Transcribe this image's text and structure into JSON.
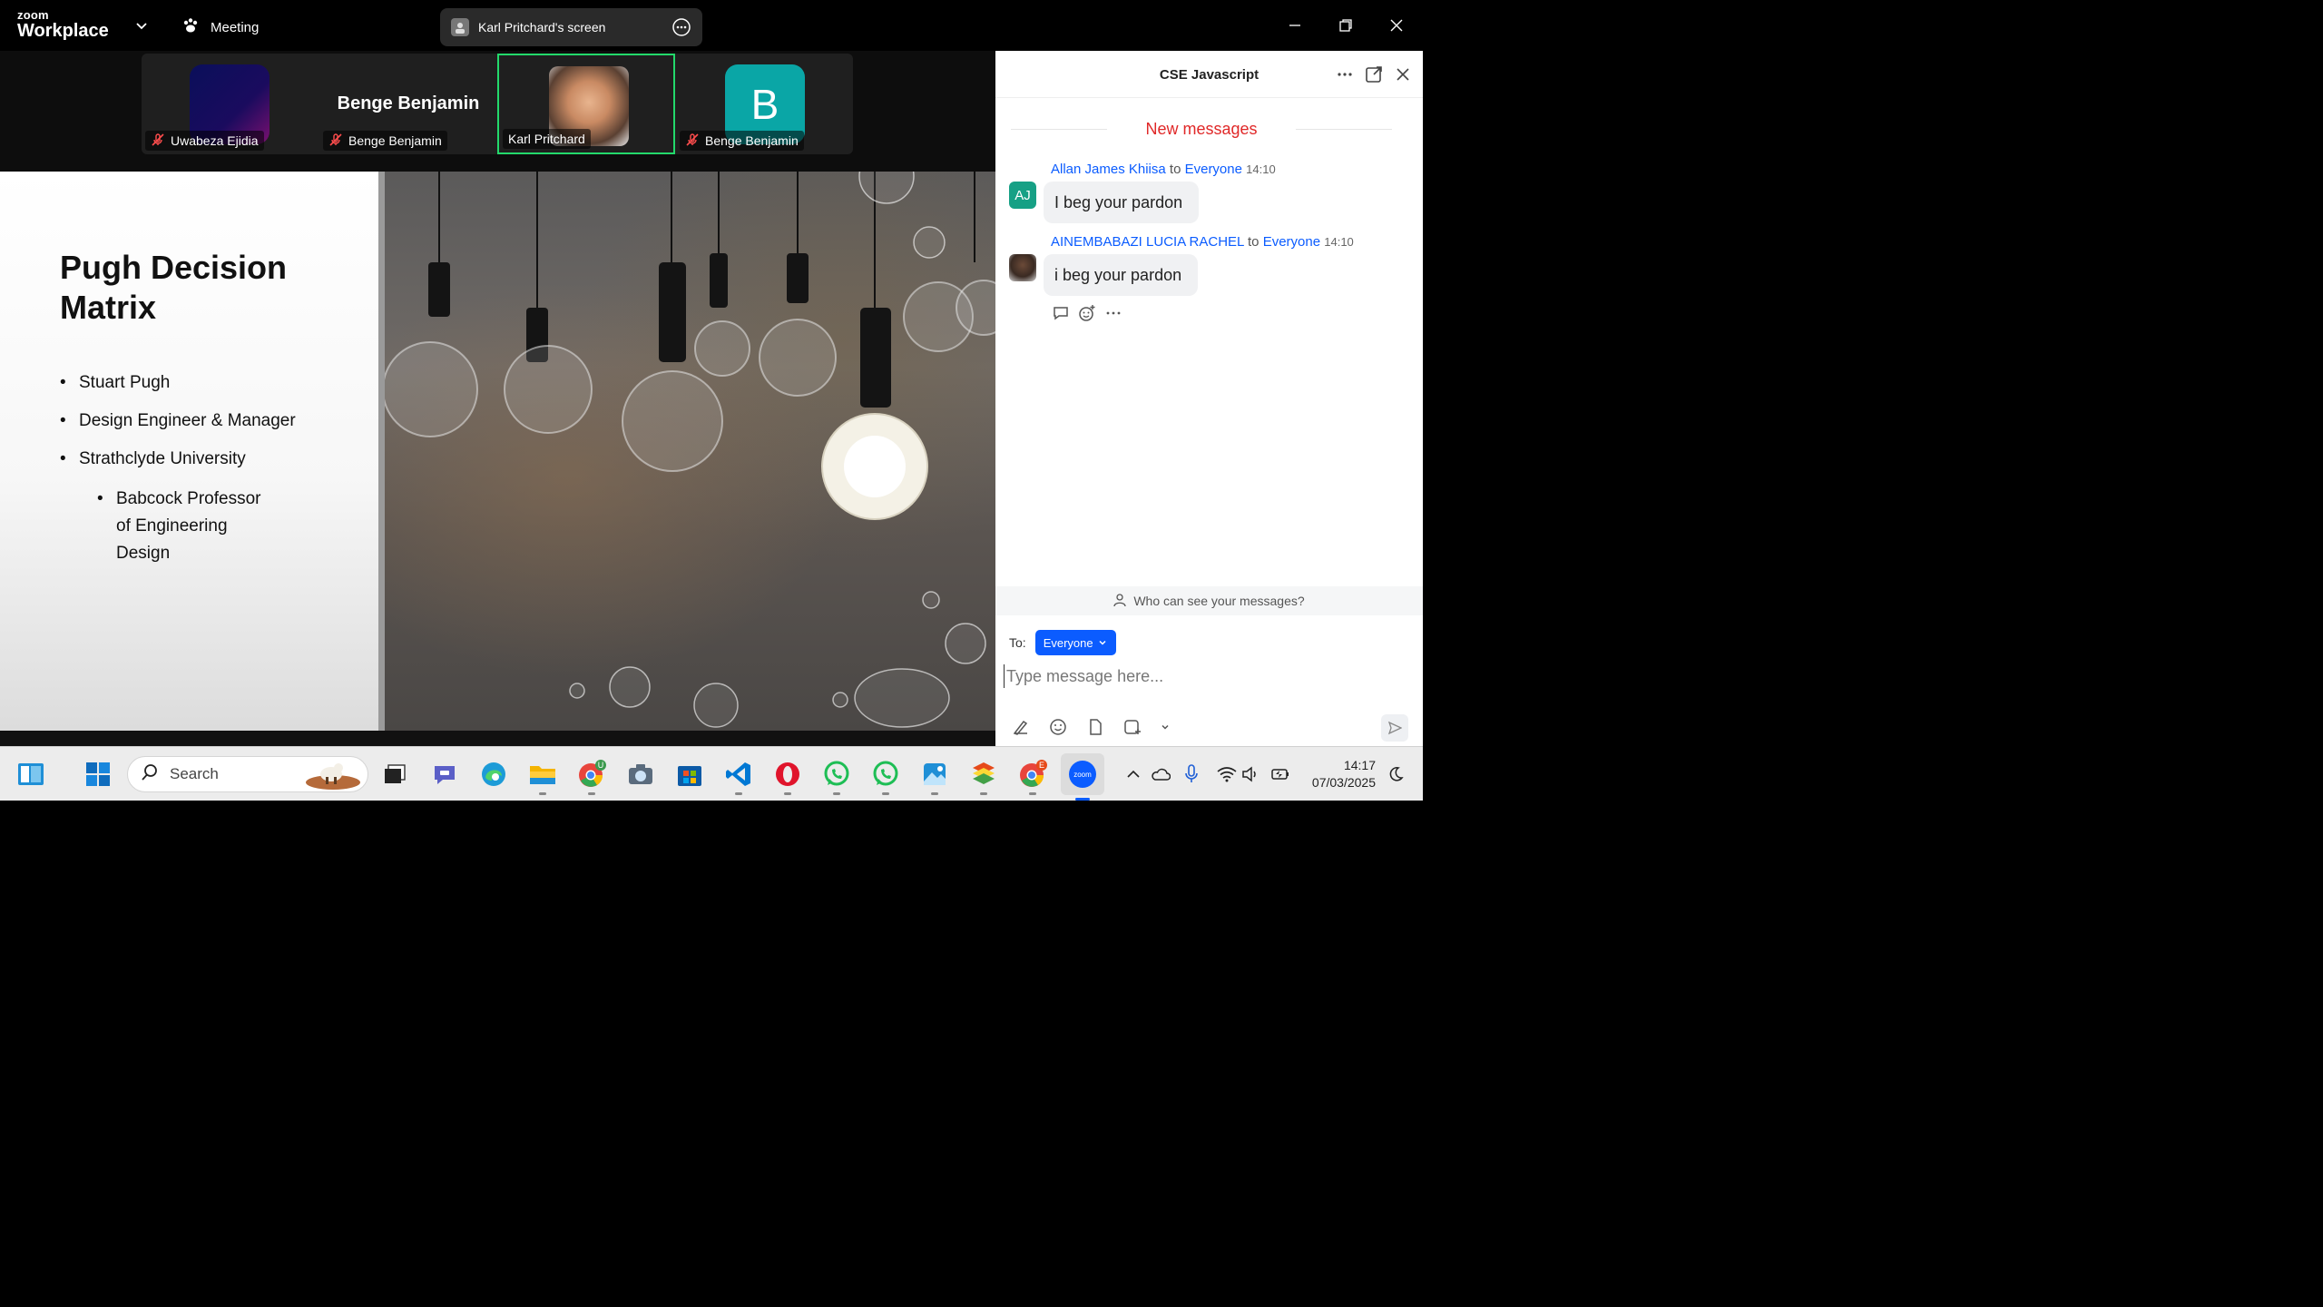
{
  "titlebar": {
    "logo_line1": "zoom",
    "logo_line2": "Workplace",
    "meeting_label": "Meeting",
    "share_label": "Karl Pritchard's screen"
  },
  "participants": [
    {
      "name": "Uwabeza Ejidia",
      "muted": true
    },
    {
      "name": "Benge Benjamin",
      "muted": true,
      "display": "Benge Benjamin"
    },
    {
      "name": "Karl Pritchard",
      "muted": false,
      "active": true
    },
    {
      "name": "Benge Benjamin",
      "muted": true,
      "avatar_letter": "B"
    }
  ],
  "slide": {
    "title": "Pugh Decision Matrix",
    "bullets": [
      "Stuart Pugh",
      "Design Engineer & Manager",
      "Strathclyde University"
    ],
    "sub_bullet": "Babcock Professor of Engineering Design"
  },
  "chat": {
    "title": "CSE Javascript",
    "new_messages": "New messages",
    "messages": [
      {
        "sender": "Allan James Khiisa",
        "to_word": "to",
        "recipient": "Everyone",
        "time": "14:10",
        "text": "I beg your pardon",
        "initials": "AJ"
      },
      {
        "sender": "AINEMBABAZI LUCIA RACHEL",
        "to_word": "to",
        "recipient": "Everyone",
        "time": "14:10",
        "text": "i beg your pardon"
      }
    ],
    "who_can_see": "Who can see your messages?",
    "to_label": "To:",
    "to_value": "Everyone",
    "compose_placeholder": "Type message here..."
  },
  "taskbar": {
    "search_placeholder": "Search",
    "chrome_badge": "U",
    "chrome2_badge": "E",
    "zoom_label": "zoom",
    "time": "14:17",
    "date": "07/03/2025"
  },
  "colors": {
    "accent": "#0b5cff",
    "new_messages": "#e02828",
    "active_speaker": "#23d96b",
    "avatar_teal": "#0aa6a6"
  }
}
